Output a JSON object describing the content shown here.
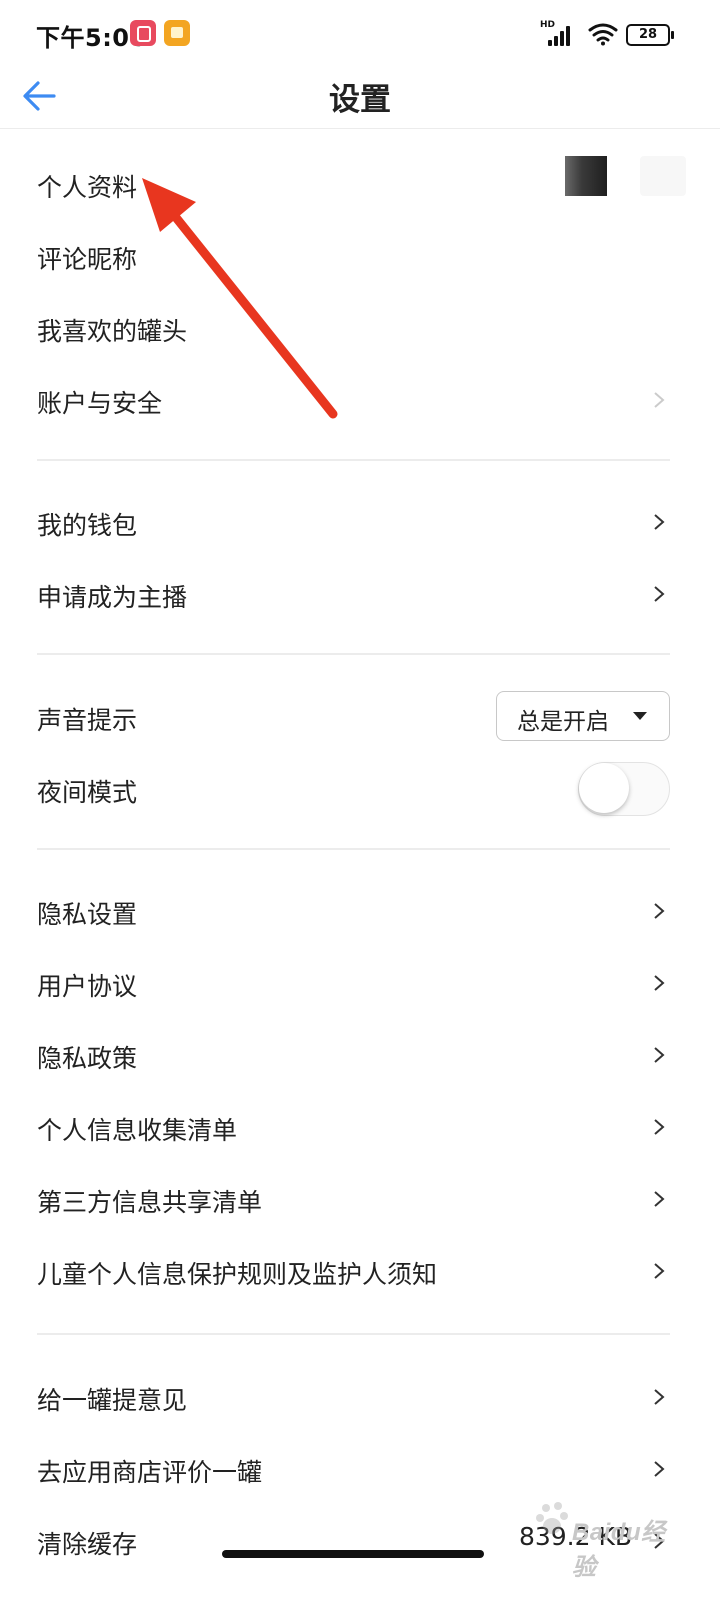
{
  "status_bar": {
    "time": "下午5:06",
    "network_label": "HD",
    "battery": "28"
  },
  "header": {
    "title": "设置",
    "back_icon": "arrow-left-icon"
  },
  "sections": [
    {
      "items": [
        {
          "label": "个人资料"
        },
        {
          "label": "评论昵称"
        },
        {
          "label": "我喜欢的罐头"
        },
        {
          "label": "账户与安全"
        }
      ]
    },
    {
      "items": [
        {
          "label": "我的钱包"
        },
        {
          "label": "申请成为主播"
        }
      ]
    },
    {
      "items": [
        {
          "label": "声音提示",
          "control": "dropdown",
          "value": "总是开启"
        },
        {
          "label": "夜间模式",
          "control": "toggle",
          "checked": false
        }
      ]
    },
    {
      "items": [
        {
          "label": "隐私设置"
        },
        {
          "label": "用户协议"
        },
        {
          "label": "隐私政策"
        },
        {
          "label": "个人信息收集清单"
        },
        {
          "label": "第三方信息共享清单"
        },
        {
          "label": "儿童个人信息保护规则及监护人须知"
        }
      ]
    },
    {
      "items": [
        {
          "label": "给一罐提意见"
        },
        {
          "label": "去应用商店评价一罐"
        },
        {
          "label": "清除缓存",
          "value": "839.2 KB"
        }
      ]
    }
  ],
  "watermark": {
    "text": "Baidu经验"
  },
  "colors": {
    "accent_blue": "#3d8bf2",
    "annotation_red": "#e8361f",
    "divider": "#ececec"
  }
}
